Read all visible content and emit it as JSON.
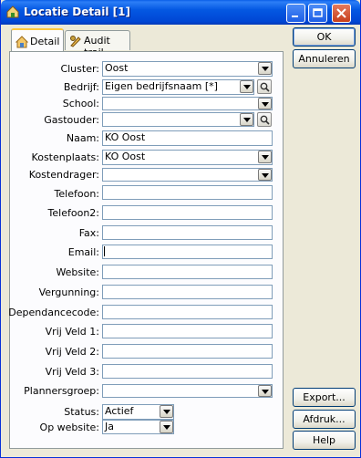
{
  "window": {
    "title": "Locatie Detail [1]"
  },
  "tabs": [
    {
      "label": "Detail",
      "icon": "house-icon"
    },
    {
      "label": "Audit trail",
      "icon": "pencil-key-icon"
    }
  ],
  "fields": {
    "cluster": {
      "label": "Cluster:",
      "value": "Oost"
    },
    "bedrijf": {
      "label": "Bedrijf:",
      "value": "Eigen bedrijfsnaam [*]"
    },
    "school": {
      "label": "School:",
      "value": ""
    },
    "gastouder": {
      "label": "Gastouder:",
      "value": ""
    },
    "naam": {
      "label": "Naam:",
      "value": "KO Oost"
    },
    "kostenplaats": {
      "label": "Kostenplaats:",
      "value": "KO Oost"
    },
    "kostendrager": {
      "label": "Kostendrager:",
      "value": ""
    },
    "telefoon": {
      "label": "Telefoon:",
      "value": ""
    },
    "telefoon2": {
      "label": "Telefoon2:",
      "value": ""
    },
    "fax": {
      "label": "Fax:",
      "value": ""
    },
    "email": {
      "label": "Email:",
      "value": ""
    },
    "website": {
      "label": "Website:",
      "value": ""
    },
    "vergunning": {
      "label": "Vergunning:",
      "value": ""
    },
    "dependancecode": {
      "label": "Dependancecode:",
      "value": ""
    },
    "vrijveld1": {
      "label": "Vrij Veld 1:",
      "value": ""
    },
    "vrijveld2": {
      "label": "Vrij Veld 2:",
      "value": ""
    },
    "vrijveld3": {
      "label": "Vrij Veld 3:",
      "value": ""
    },
    "plannersgroep": {
      "label": "Plannersgroep:",
      "value": ""
    },
    "status": {
      "label": "Status:",
      "value": "Actief"
    },
    "opwebsite": {
      "label": "Op website:",
      "value": "Ja"
    }
  },
  "buttons": {
    "ok": "OK",
    "annuleren": "Annuleren",
    "export": "Export...",
    "afdruk": "Afdruk...",
    "help": "Help"
  },
  "colors": {
    "titlebar": "#0054e3",
    "accent_tab": "#ffc83c",
    "field_border": "#7f9db9"
  }
}
